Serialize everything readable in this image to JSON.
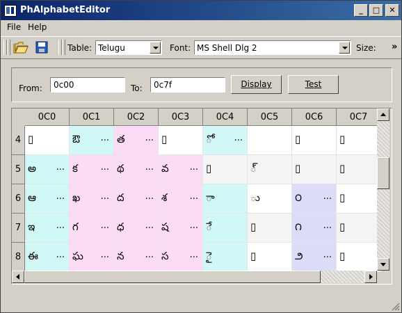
{
  "window": {
    "title": "PhAlphabetEditor"
  },
  "title_buttons": {
    "minimize": "_",
    "maximize": "□",
    "close": "✕"
  },
  "menu": [
    "File",
    "Help"
  ],
  "toolbar": {
    "table_label": "Table:",
    "table_value": "Telugu",
    "font_label": "Font:",
    "font_value": "MS Shell Dlg 2",
    "size_label": "Size:",
    "overflow": "»"
  },
  "range": {
    "from_label": "From:",
    "from_value": "0c00",
    "to_label": "To:",
    "to_value": "0c7f",
    "display_button": "Display",
    "test_button": "Test"
  },
  "grid": {
    "columns": [
      "0C0",
      "0C1",
      "0C2",
      "0C3",
      "0C4",
      "0C5",
      "0C6",
      "0C7"
    ],
    "rows": [
      {
        "label": "4",
        "cells": [
          {
            "ch": "▯",
            "el": "",
            "bg": "#ffffff"
          },
          {
            "ch": "ఔ",
            "el": "...",
            "bg": "#d2f7f7"
          },
          {
            "ch": "త",
            "el": "...",
            "bg": "#fcdcf4"
          },
          {
            "ch": "▯",
            "el": "",
            "bg": "#ffffff"
          },
          {
            "ch": "ో",
            "el": "...",
            "bg": "#d2f7f7"
          },
          {
            "ch": "",
            "el": "",
            "bg": "#ffffff"
          },
          {
            "ch": "▯",
            "el": "",
            "bg": "#ffffff"
          },
          {
            "ch": "▯",
            "el": "",
            "bg": "#ffffff"
          }
        ]
      },
      {
        "label": "5",
        "cells": [
          {
            "ch": "అ",
            "el": "...",
            "bg": "#d2f7f7"
          },
          {
            "ch": "క",
            "el": "...",
            "bg": "#fcdcf4"
          },
          {
            "ch": "థ",
            "el": "...",
            "bg": "#fcdcf4"
          },
          {
            "ch": "వ",
            "el": "...",
            "bg": "#fcdcf4"
          },
          {
            "ch": "▯",
            "el": "",
            "bg": "#f4f4f4"
          },
          {
            "ch": "్",
            "el": "",
            "bg": "#f4f4f4"
          },
          {
            "ch": "▯",
            "el": "",
            "bg": "#f4f4f4"
          },
          {
            "ch": "▯",
            "el": "",
            "bg": "#f4f4f4"
          }
        ]
      },
      {
        "label": "6",
        "cells": [
          {
            "ch": "ఆ",
            "el": "...",
            "bg": "#d2f7f7"
          },
          {
            "ch": "ఖ",
            "el": "...",
            "bg": "#fcdcf4"
          },
          {
            "ch": "ద",
            "el": "...",
            "bg": "#fcdcf4"
          },
          {
            "ch": "శ",
            "el": "...",
            "bg": "#fcdcf4"
          },
          {
            "ch": "ా",
            "el": "",
            "bg": "#d2f7f7"
          },
          {
            "ch": "ు",
            "el": "",
            "bg": "#ffffff"
          },
          {
            "ch": "౦",
            "el": "...",
            "bg": "#dcdcf8"
          },
          {
            "ch": "▯",
            "el": "",
            "bg": "#ffffff"
          }
        ]
      },
      {
        "label": "7",
        "cells": [
          {
            "ch": "ఇ",
            "el": "...",
            "bg": "#d2f7f7"
          },
          {
            "ch": "గ",
            "el": "...",
            "bg": "#fcdcf4"
          },
          {
            "ch": "ధ",
            "el": "...",
            "bg": "#fcdcf4"
          },
          {
            "ch": "ష",
            "el": "...",
            "bg": "#fcdcf4"
          },
          {
            "ch": "ే",
            "el": "",
            "bg": "#d2f7f7"
          },
          {
            "ch": "▯",
            "el": "",
            "bg": "#f4f4f4"
          },
          {
            "ch": "౧",
            "el": "...",
            "bg": "#dcdcf8"
          },
          {
            "ch": "▯",
            "el": "",
            "bg": "#f4f4f4"
          }
        ]
      },
      {
        "label": "8",
        "cells": [
          {
            "ch": "ఈ",
            "el": "...",
            "bg": "#d2f7f7"
          },
          {
            "ch": "ఘ",
            "el": "...",
            "bg": "#fcdcf4"
          },
          {
            "ch": "న",
            "el": "...",
            "bg": "#fcdcf4"
          },
          {
            "ch": "స",
            "el": "...",
            "bg": "#fcdcf4"
          },
          {
            "ch": "ై",
            "el": "",
            "bg": "#d2f7f7"
          },
          {
            "ch": "▯",
            "el": "",
            "bg": "#ffffff"
          },
          {
            "ch": "౨",
            "el": "...",
            "bg": "#dcdcf8"
          },
          {
            "ch": "▯",
            "el": "",
            "bg": "#ffffff"
          }
        ]
      }
    ]
  },
  "colors": {
    "titlebar_start": "#0a246a",
    "titlebar_end": "#3a6ea5",
    "face": "#d4d0c8"
  },
  "icons": {
    "app": "app-icon",
    "open": "folder-open-icon",
    "save": "floppy-disk-icon"
  }
}
